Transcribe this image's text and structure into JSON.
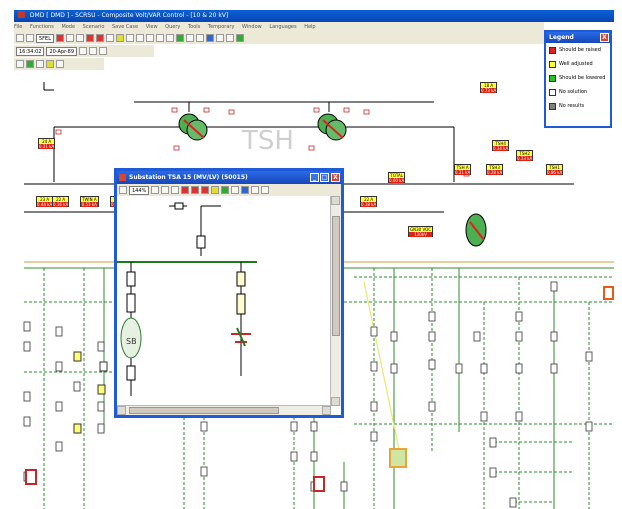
{
  "window": {
    "title": "DMD [ DMD ] - SCRSU - Composite Volt/VAR Control - [10 & 20 kV]"
  },
  "menu": {
    "items": [
      "File",
      "Functions",
      "Mode",
      "Scenario",
      "Save Case",
      "View",
      "Query",
      "Tools",
      "Temporary",
      "Window",
      "Languages",
      "Help"
    ]
  },
  "toolbar": {
    "combo_value": "5FEL",
    "time_value": "16:34:02",
    "date_value": "20-Apr-89"
  },
  "diagram": {
    "station_label": "TSH",
    "meas_labels": [
      {
        "name": "24 A",
        "val": "0.21 kA"
      },
      {
        "name": "23 A",
        "val": "0.44 kA"
      },
      {
        "name": "22 A",
        "val": "0.16 kA"
      },
      {
        "name": "TWIN A",
        "val": "0.53 kA"
      },
      {
        "name": "21 A",
        "val": "0.12 kA"
      },
      {
        "name": "18 A",
        "val": "0.73 kA"
      },
      {
        "name": "TSH4",
        "val": "0.34 kA"
      },
      {
        "name": "TSH A",
        "val": "0.21 kA"
      },
      {
        "name": "TSH3",
        "val": "0.28 kA"
      },
      {
        "name": "TSH2",
        "val": "0.23 kA"
      },
      {
        "name": "TSH1",
        "val": "0.86 kA"
      },
      {
        "name": "GN30 VOC",
        "val": "120kV"
      },
      {
        "name": "22 A",
        "val": "0.18 kA"
      },
      {
        "name": "TOTAL",
        "val": "0.00 kA"
      }
    ]
  },
  "legend": {
    "title": "Legend",
    "close": "X",
    "items": [
      {
        "label": "Should be raised",
        "color": "#e02020"
      },
      {
        "label": "Well adjusted",
        "color": "#ffff33"
      },
      {
        "label": "Should be lowered",
        "color": "#22c322"
      },
      {
        "label": "No solution",
        "color": "#ffffff"
      },
      {
        "label": "No results",
        "color": "#808080"
      }
    ]
  },
  "popup": {
    "title": "Substation TSA 15 (MV/LV) (50015)",
    "combo_value": "144%",
    "minimize": "_",
    "maximize": "□",
    "close": "X",
    "transformer_label": "SB"
  }
}
